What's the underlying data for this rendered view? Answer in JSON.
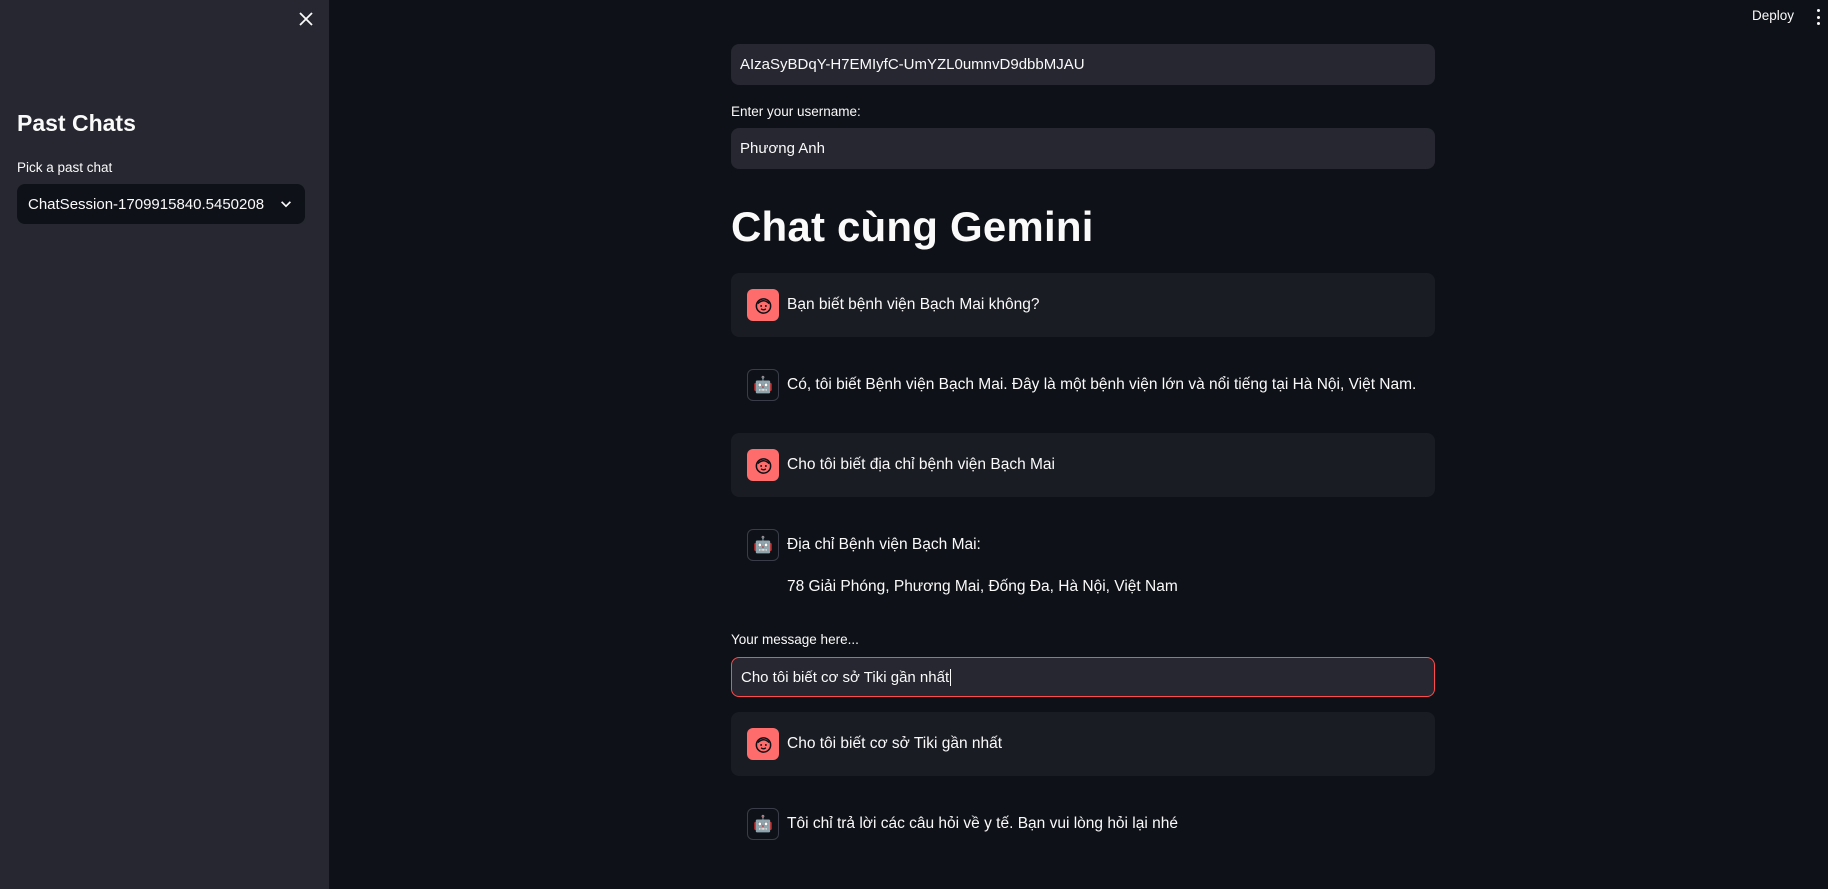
{
  "sidebar": {
    "close_icon": "close-icon",
    "title": "Past Chats",
    "select_label": "Pick a past chat",
    "select_value": "ChatSession-1709915840.5450208"
  },
  "header": {
    "deploy_label": "Deploy",
    "menu_icon": "vertical-dots-icon"
  },
  "api_key": {
    "value": "AIzaSyBDqY-H7EMIyfC-UmYZL0umnvD9dbbMJAU"
  },
  "username": {
    "label": "Enter your username:",
    "value": "Phương Anh"
  },
  "page_title": "Chat cùng Gemini",
  "messages_top": [
    {
      "role": "user",
      "avatar_icon": "user-face-icon",
      "text": "Bạn biết bệnh viện Bạch Mai không?"
    },
    {
      "role": "assistant",
      "avatar_icon": "robot-icon",
      "text": "Có, tôi biết Bệnh viện Bạch Mai. Đây là một bệnh viện lớn và nổi tiếng tại Hà Nội, Việt Nam."
    },
    {
      "role": "user",
      "avatar_icon": "user-face-icon",
      "text": "Cho tôi biết địa chỉ bệnh viện Bạch Mai"
    },
    {
      "role": "assistant",
      "avatar_icon": "robot-icon",
      "text": "Địa chỉ Bệnh viện Bạch Mai:",
      "text2": "78 Giải Phóng, Phương Mai, Đống Đa, Hà Nội, Việt Nam"
    }
  ],
  "message_input": {
    "label": "Your message here...",
    "value": "Cho tôi biết cơ sở Tiki gần nhất"
  },
  "messages_bottom": [
    {
      "role": "user",
      "avatar_icon": "user-face-icon",
      "text": "Cho tôi biết cơ sở Tiki gần nhất"
    },
    {
      "role": "assistant",
      "avatar_icon": "robot-icon",
      "text": "Tôi chỉ trả lời các câu hỏi về y tế. Bạn vui lòng hỏi lại nhé"
    }
  ],
  "colors": {
    "background": "#0e1117",
    "sidebar": "#262730",
    "input": "#262730",
    "user_message": "#1a1c24",
    "user_avatar": "#ff6c6c",
    "focus_border": "#ff4b4b",
    "text": "#fafafa"
  }
}
